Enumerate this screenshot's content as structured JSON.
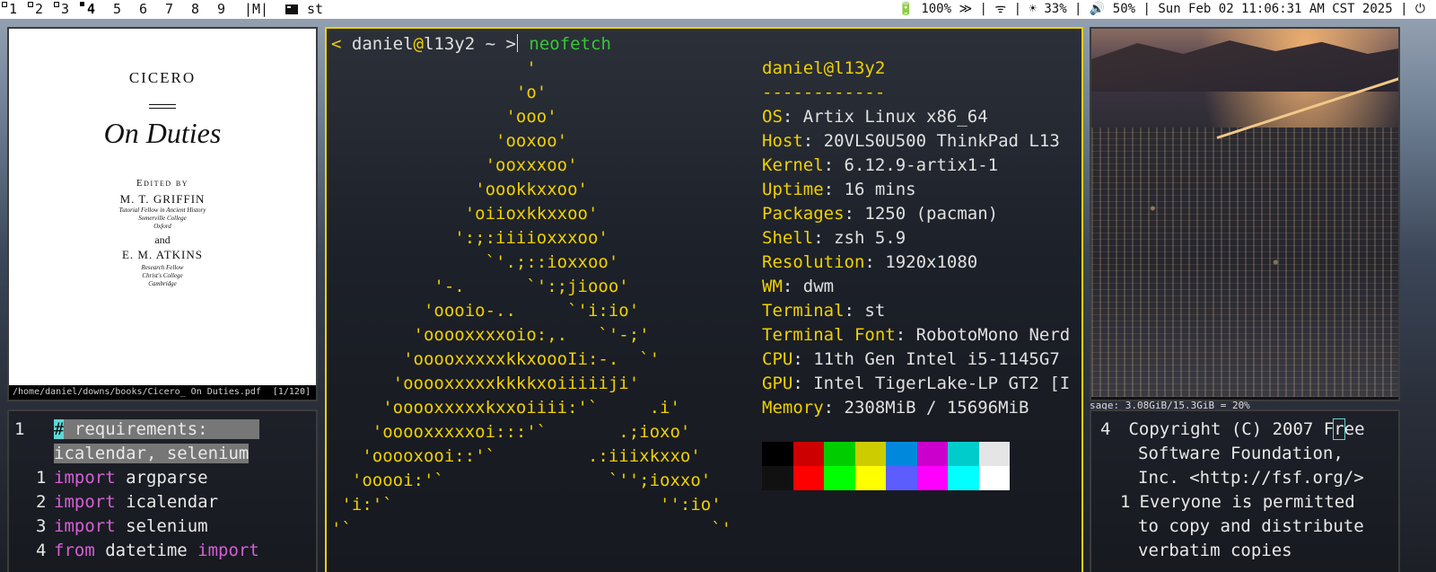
{
  "topbar": {
    "tags": [
      "1",
      "2",
      "3",
      "4",
      "5",
      "6",
      "7",
      "8",
      "9"
    ],
    "selected_tag": "4",
    "layout": "|M|",
    "window_title": "st",
    "status": "🔋 100% ≫ | ᯤ | ☀ 33% | 🔊 50% | Sun Feb 02 11:06:31 AM CST 2025 | ⏻"
  },
  "pdf_viewer": {
    "author": "CICERO",
    "title": "On Duties",
    "edited_by": "Edited by",
    "editor1": "M. T. GRIFFIN",
    "editor1_affil": [
      "Tutorial Fellow in Ancient History",
      "Somerville College",
      "Oxford"
    ],
    "and": "and",
    "editor2": "E. M. ATKINS",
    "editor2_affil": [
      "Research Fellow",
      "Christ's College",
      "Cambridge"
    ],
    "file_path": "/home/daniel/downs/books/Cicero_ On Duties.pdf",
    "page_indicator": "[1/120]"
  },
  "editor": {
    "current_line_no": "1",
    "lines": [
      {
        "no": "",
        "comment": "# requirements:"
      },
      {
        "no": "",
        "comment": "icalendar, selenium"
      },
      {
        "no": "1",
        "kw": "import",
        "rest": " argparse"
      },
      {
        "no": "2",
        "kw": "import",
        "rest": " icalendar"
      },
      {
        "no": "3",
        "kw": "import",
        "rest": " selenium"
      },
      {
        "no": "4",
        "kw": "from",
        "rest": " datetime ",
        "kw2": "import"
      }
    ]
  },
  "terminal": {
    "prompt_open": "< ",
    "prompt_user": "daniel",
    "prompt_at": "@",
    "prompt_host": "l13y2",
    "prompt_path": " ~ >",
    "command": " neofetch",
    "logo": [
      "                   '",
      "                  'o'",
      "                 'ooo'",
      "                'ooxoo'",
      "               'ooxxxoo'",
      "              'oookkxxoo'",
      "             'oiioxkkxxoo'",
      "            ':;:iiiioxxxoo'",
      "               `'.;::ioxxoo'",
      "          '-.      `':;jiooo'",
      "         'oooio-..     `'i:io'",
      "        'ooooxxxxoio:,.   `'-;'",
      "       'ooooxxxxxkkxoooIi:-.  `'",
      "      'ooooxxxxxkkkkxoiiiiiji'",
      "     'ooooxxxxxkxxoiiii:'`     .i'",
      "    'ooooxxxxxoi:::'`       .;ioxo'",
      "   'ooooxooi::'`         .:iiixkxxo'",
      "  'ooooi:'`                `'';ioxxo'",
      " 'i:'`                          '':io'",
      "'`                                   `'"
    ],
    "info_title": "daniel@l13y2",
    "info_separator": "------------",
    "info": [
      {
        "key": "OS",
        "value": "Artix Linux x86_64"
      },
      {
        "key": "Host",
        "value": "20VLS0U500 ThinkPad L13"
      },
      {
        "key": "Kernel",
        "value": "6.12.9-artix1-1"
      },
      {
        "key": "Uptime",
        "value": "16 mins"
      },
      {
        "key": "Packages",
        "value": "1250 (pacman)"
      },
      {
        "key": "Shell",
        "value": "zsh 5.9"
      },
      {
        "key": "Resolution",
        "value": "1920x1080"
      },
      {
        "key": "WM",
        "value": "dwm"
      },
      {
        "key": "Terminal",
        "value": "st"
      },
      {
        "key": "Terminal Font",
        "value": "RobotoMono Nerd"
      },
      {
        "key": "CPU",
        "value": "11th Gen Intel i5-1145G7"
      },
      {
        "key": "GPU",
        "value": "Intel TigerLake-LP GT2 [I"
      },
      {
        "key": "Memory",
        "value": "2308MiB / 15696MiB"
      }
    ],
    "palette_top": [
      "#000000",
      "#cc0000",
      "#00cc00",
      "#cccc00",
      "#0088dd",
      "#cc00cc",
      "#00cccc",
      "#e5e5e5"
    ],
    "palette_bottom": [
      "#111111",
      "#ff0000",
      "#00ff00",
      "#ffff00",
      "#5c5cff",
      "#ff00ff",
      "#00ffff",
      "#ffffff"
    ]
  },
  "right_text": {
    "lines": [
      {
        "no": "4",
        "text": " Copyright (C) 2007 F",
        "cursor": "r",
        "tail": "ee"
      },
      {
        "no": "",
        "text": "Software Foundation,"
      },
      {
        "no": "",
        "text": "Inc. <http://fsf.org/>"
      },
      {
        "no": "1",
        "text": " Everyone is permitted"
      },
      {
        "no": "",
        "text": "to copy and distribute"
      },
      {
        "no": "",
        "text": "verbatim copies"
      }
    ],
    "behind_fragment": "sage: 3.08GiB/15.3GiB = 20%",
    "left_fragments": [
      "s",
      "s",
      "s",
      "s",
      "s",
      "1"
    ]
  }
}
